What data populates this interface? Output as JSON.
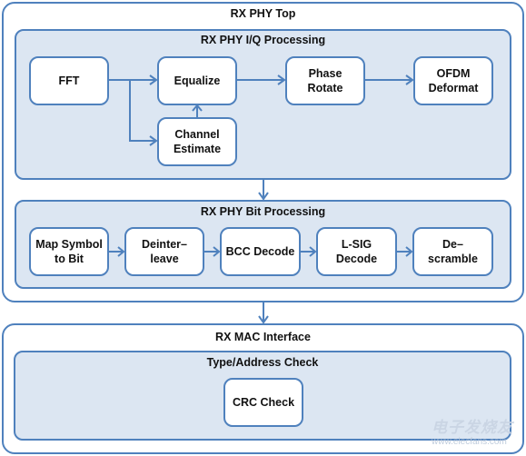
{
  "diagram": {
    "phy_top": {
      "title": "RX PHY Top",
      "iq_processing": {
        "title": "RX PHY I/Q Processing",
        "blocks": [
          "FFT",
          "Equalize",
          "Channel\nEstimate",
          "Phase\nRotate",
          "OFDM\nDeformat"
        ]
      },
      "bit_processing": {
        "title": "RX PHY Bit Processing",
        "blocks": [
          "Map Symbol\nto Bit",
          "Deinter–\nleave",
          "BCC Decode",
          "L-SIG\nDecode",
          "De–\nscramble"
        ]
      }
    },
    "mac_interface": {
      "title": "RX MAC Interface",
      "type_address": {
        "title": "Type/Address Check",
        "blocks": [
          "CRC Check"
        ]
      }
    },
    "edges": [
      [
        "FFT",
        "Equalize"
      ],
      [
        "FFT",
        "Channel Estimate"
      ],
      [
        "Channel Estimate",
        "Equalize"
      ],
      [
        "Equalize",
        "Phase Rotate"
      ],
      [
        "Phase Rotate",
        "OFDM Deformat"
      ],
      [
        "RX PHY I/Q Processing",
        "RX PHY Bit Processing"
      ],
      [
        "Map Symbol to Bit",
        "Deinterleave"
      ],
      [
        "Deinterleave",
        "BCC Decode"
      ],
      [
        "BCC Decode",
        "L-SIG Decode"
      ],
      [
        "L-SIG Decode",
        "Descramble"
      ],
      [
        "RX PHY Top",
        "RX MAC Interface"
      ]
    ],
    "colors": {
      "stroke": "#4f81bd",
      "group_fill": "#dce6f2",
      "block_fill": "#ffffff"
    },
    "watermark": {
      "brand": "电子发烧友",
      "site": "www.elecfans.com"
    }
  }
}
